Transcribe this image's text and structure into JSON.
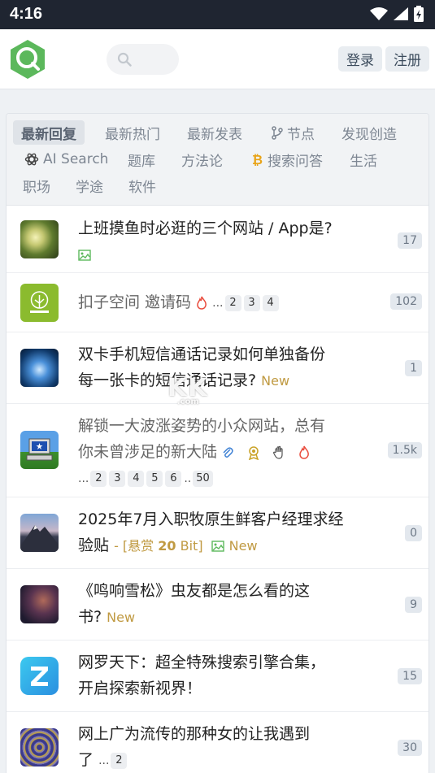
{
  "status": {
    "time": "4:16"
  },
  "header": {
    "search_placeholder": "",
    "login": "登录",
    "register": "注册"
  },
  "tabs": [
    {
      "label": "最新回复",
      "active": true
    },
    {
      "label": "最新热门"
    },
    {
      "label": "最新发表"
    },
    {
      "label": "节点",
      "icon": "branch-icon"
    },
    {
      "label": "发现创造"
    },
    {
      "label": "AI Search",
      "icon": "openai-icon"
    },
    {
      "label": "题库"
    },
    {
      "label": "方法论"
    },
    {
      "label": "搜索问答",
      "icon": "bitcoin-icon"
    },
    {
      "label": "生活"
    },
    {
      "label": "职场"
    },
    {
      "label": "学途"
    },
    {
      "label": "软件"
    }
  ],
  "topics": [
    {
      "line1": "上班摸鱼时必逛的三个网站 / App是?",
      "count": "17"
    },
    {
      "line1": "扣子空间 邀请码",
      "pages": [
        "...",
        "2",
        "3",
        "4"
      ],
      "count": "102"
    },
    {
      "line1": "双卡手机短信通话记录如何单独备份",
      "line2": "每一张卡的短信通话记录?",
      "new": "New",
      "count": "1"
    },
    {
      "line1": "解锁一大波涨姿势的小众网站，总有",
      "line2": "你未曾涉足的新大陆",
      "pages": [
        "...",
        "2",
        "3",
        "4",
        "5",
        "6",
        "..",
        "50"
      ],
      "count": "1.5k"
    },
    {
      "line1": "2025年7月入职牧原生鲜客户经理求经",
      "line2": "验贴",
      "bounty_pre": "- [悬赏 ",
      "bounty_num": "20",
      "bounty_post": " Bit]",
      "new": "New",
      "count": "0"
    },
    {
      "line1": "《鸣响雪松》虫友都是怎么看的这",
      "line2": "书?",
      "new": "New",
      "count": "9"
    },
    {
      "line1": "网罗天下：超全特殊搜索引擎合集，",
      "line2": "开启探索新视界！",
      "count": "15"
    },
    {
      "line1": "网上广为流传的那种女的让我遇到",
      "line2": "了",
      "pages": [
        "...",
        "2"
      ],
      "count": "30"
    }
  ],
  "watermark": {
    "main": "KK",
    "sub": ".com"
  },
  "colors": {
    "accent": "#5cb85c",
    "new": "#c09a42",
    "statusbar": "#1f2531"
  }
}
